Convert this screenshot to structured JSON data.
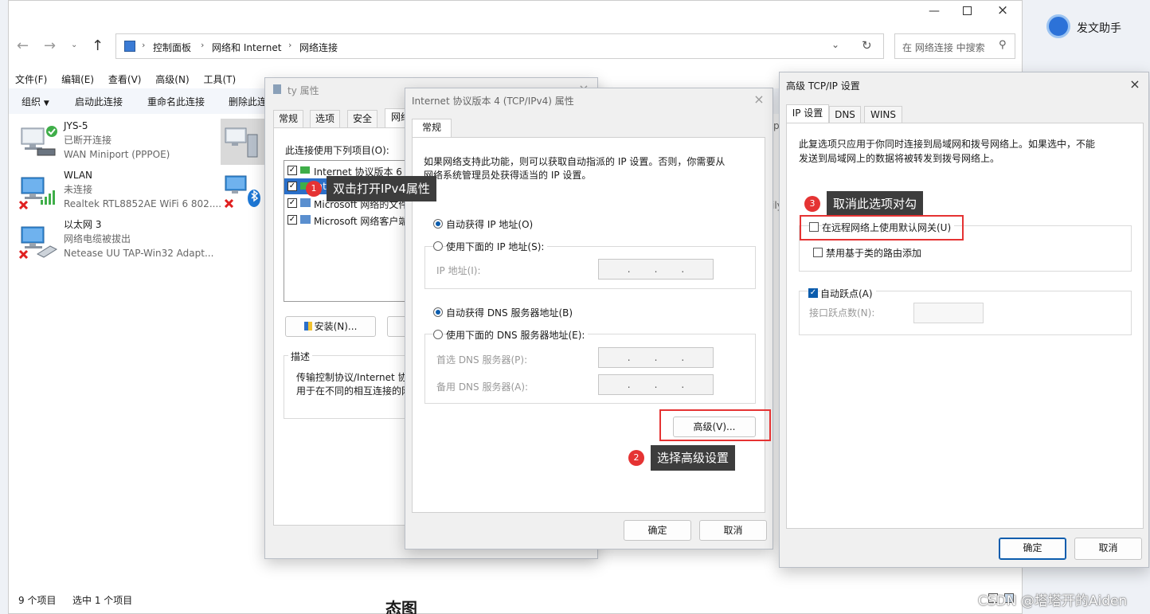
{
  "explorer": {
    "breadcrumb": [
      "控制面板",
      "网络和 Internet",
      "网络连接"
    ],
    "search_placeholder": "在 网络连接 中搜索",
    "menu": [
      "文件(F)",
      "编辑(E)",
      "查看(V)",
      "高级(N)",
      "工具(T)"
    ],
    "commands": [
      "组织",
      "启动此连接",
      "重命名此连接",
      "删除此连接"
    ],
    "connections": [
      {
        "name": "JYS-5",
        "status": "已断开连接",
        "device": "WAN Miniport (PPPOE)"
      },
      {
        "name": "WLAN",
        "status": "未连接",
        "device": "Realtek RTL8852AE WiFi 6 802...."
      },
      {
        "name": "以太网 3",
        "status": "网络电缆被拔出",
        "device": "Netease UU TAP-Win32 Adapt..."
      }
    ],
    "partial_right_text": [
      "p",
      "ily"
    ],
    "status": {
      "count": "9 个项目",
      "selected": "选中 1 个项目"
    }
  },
  "assistant": {
    "label": "发文助手"
  },
  "watermark": "CSDN @塔塔开的Aiden",
  "bottom_partial_text": "态图",
  "props": {
    "title": "ty 属性",
    "tabs": [
      "常规",
      "选项",
      "安全",
      "网络"
    ],
    "list_label": "此连接使用下列项目(O):",
    "items": [
      {
        "label": "Internet 协议版本 6 (",
        "checked": true
      },
      {
        "label": "Inte",
        "checked": true
      },
      {
        "label": "Microsoft 网络的文件",
        "checked": true
      },
      {
        "label": "Microsoft 网络客户端",
        "checked": true
      }
    ],
    "install_button": "安装(N)...",
    "desc_label": "描述",
    "desc_text": [
      "传输控制协议/Internet 协",
      "用于在不同的相互连接的网"
    ]
  },
  "ipv4": {
    "title": "Internet 协议版本 4 (TCP/IPv4) 属性",
    "tab": "常规",
    "intro": [
      "如果网络支持此功能，则可以获取自动指派的 IP 设置。否则，你需要从",
      "网络系统管理员处获得适当的 IP 设置。"
    ],
    "auto_ip": "自动获得 IP 地址(O)",
    "manual_ip": "使用下面的 IP 地址(S):",
    "ip_label": "IP 地址(I):",
    "auto_dns": "自动获得 DNS 服务器地址(B)",
    "manual_dns": "使用下面的 DNS 服务器地址(E):",
    "pref_dns": "首选 DNS 服务器(P):",
    "alt_dns": "备用 DNS 服务器(A):",
    "ip_dots": "...",
    "advanced": "高级(V)...",
    "ok": "确定",
    "cancel": "取消"
  },
  "adv": {
    "title": "高级 TCP/IP 设置",
    "tabs": [
      "IP 设置",
      "DNS",
      "WINS"
    ],
    "info": [
      "此复选项只应用于你同时连接到局域网和拨号网络上。如果选中，不能",
      "发送到局域网上的数据将被转发到拨号网络上。"
    ],
    "remote_gateway": "在远程网络上使用默认网关(U)",
    "class_route": "禁用基于类的路由添加",
    "auto_metric": "自动跃点(A)",
    "metric_label": "接口跃点数(N):",
    "ok": "确定",
    "cancel": "取消"
  },
  "callouts": [
    {
      "num": "1",
      "text": "双击打开IPv4属性"
    },
    {
      "num": "2",
      "text": "选择高级设置"
    },
    {
      "num": "3",
      "text": "取消此选项对勾"
    }
  ],
  "colors": {
    "accent": "#0b5cad",
    "highlight": "#e53333",
    "callout_bg": "#3d3d3d"
  }
}
